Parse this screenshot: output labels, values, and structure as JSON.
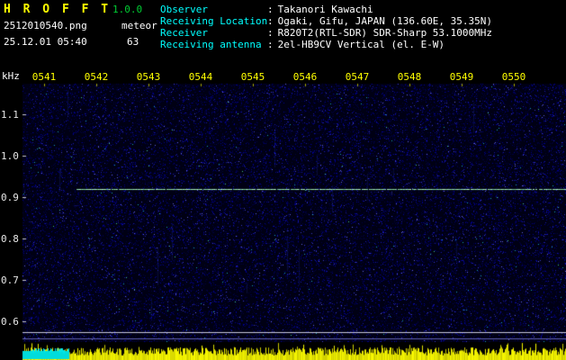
{
  "header": {
    "app_name": "H R O F F T",
    "version": "1.0.0",
    "filename": "2512010540.png",
    "mode": "meteor",
    "datetime": "25.12.01 05:40",
    "count": "63",
    "separator": ":",
    "info": [
      {
        "label": "Observer",
        "value": "Takanori Kawachi"
      },
      {
        "label": "Receiving Location",
        "value": "Ogaki, Gifu, JAPAN (136.60E, 35.35N)"
      },
      {
        "label": "Receiver",
        "value": "R820T2(RTL-SDR) SDR-Sharp 53.1000MHz"
      },
      {
        "label": "Receiving antenna",
        "value": "2el-HB9CV Vertical (el. E-W)"
      }
    ]
  },
  "chart_data": {
    "type": "heatmap",
    "subtype": "radio-meteor-spectrogram",
    "x_ticks": [
      "0541",
      "0542",
      "0543",
      "0544",
      "0545",
      "0546",
      "0547",
      "0548",
      "0549",
      "0550"
    ],
    "y_label": "kHz",
    "y_ticks_khz": [
      1.1,
      1.0,
      0.9,
      0.8,
      0.7,
      0.6
    ],
    "y_range_khz": [
      0.55,
      1.17
    ],
    "carrier_line": {
      "freq_khz": 0.92,
      "start_frac": 0.1,
      "end_frac": 1.0,
      "color": "#8cd2a0"
    },
    "baseline_lines": [
      {
        "freq_khz": 0.575,
        "color": "#c8c8dc"
      },
      {
        "freq_khz": 0.558,
        "color": "#6060b0"
      }
    ],
    "noise_band": {
      "color": "#e1e100",
      "left_block_color": "#00dcdc",
      "left_block_frac": 0.086
    },
    "colors": {
      "background": "#000014",
      "tick_label": "#ffff00",
      "axis_label": "#ffffff",
      "x_tick_mark": "#a8a800",
      "y_tick_mark": "#c8c8c8"
    }
  }
}
